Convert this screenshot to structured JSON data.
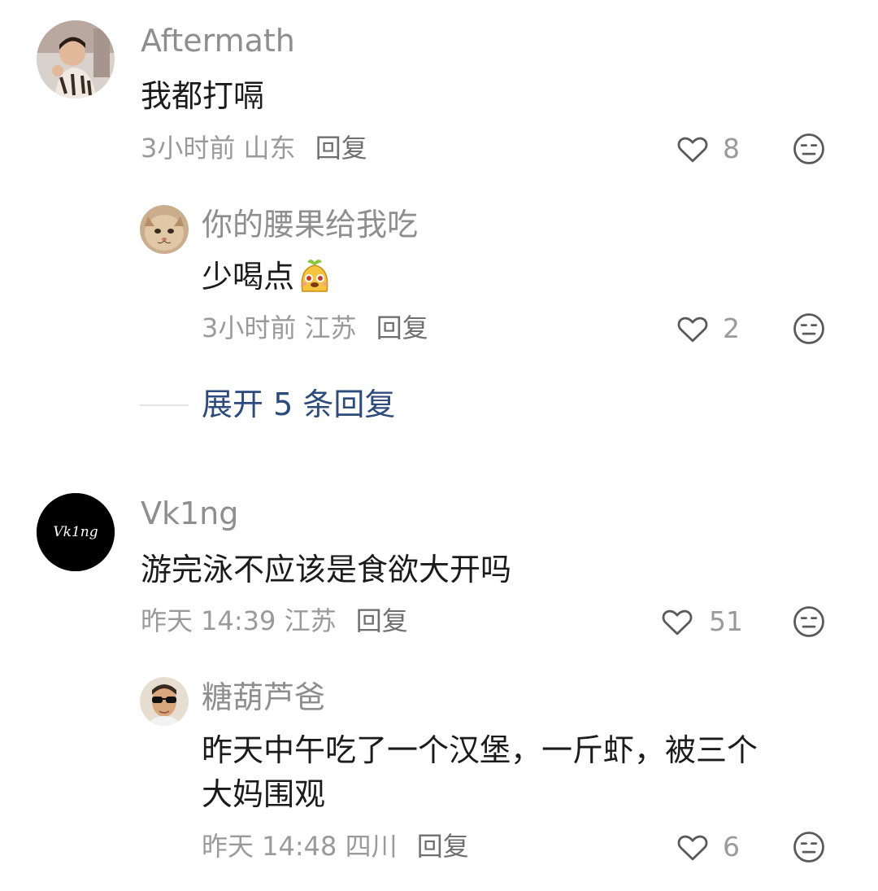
{
  "comments": [
    {
      "username": "Aftermath",
      "text": "我都打嗝",
      "time": "3小时前",
      "location": "山东",
      "reply_label": "回复",
      "likes": "8",
      "replies": [
        {
          "username": "你的腰果给我吃",
          "text": "少喝点",
          "emoji": "cute-sticker-icon",
          "time": "3小时前",
          "location": "江苏",
          "reply_label": "回复",
          "likes": "2"
        }
      ],
      "expand_label": "展开 5 条回复"
    },
    {
      "username": "Vk1ng",
      "text": "游完泳不应该是食欲大开吗",
      "time": "昨天 14:39",
      "location": "江苏",
      "reply_label": "回复",
      "likes": "51",
      "avatar_lettering": "Vk1ng",
      "replies": [
        {
          "username": "糖葫芦爸",
          "text_line1": "昨天中午吃了一个汉堡，一斤虾，被三个",
          "text_line2": "大妈围观",
          "time": "昨天 14:48",
          "location": "四川",
          "reply_label": "回复",
          "likes": "6"
        }
      ]
    }
  ],
  "colors": {
    "username": "#8e8e8e",
    "text": "#1b1b1b",
    "meta": "#9a9a9a",
    "expand": "#2c4b7c",
    "icon": "#5a5a5a"
  }
}
